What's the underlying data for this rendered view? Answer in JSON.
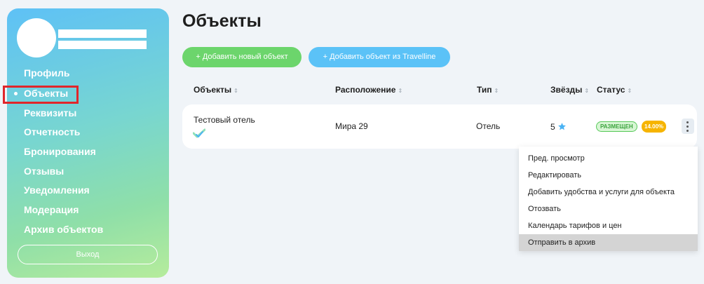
{
  "sidebar": {
    "items": [
      {
        "label": "Профиль"
      },
      {
        "label": "Объекты"
      },
      {
        "label": "Реквизиты"
      },
      {
        "label": "Отчетность"
      },
      {
        "label": "Бронирования"
      },
      {
        "label": "Отзывы"
      },
      {
        "label": "Уведомления"
      },
      {
        "label": "Модерация"
      },
      {
        "label": "Архив объектов"
      }
    ],
    "logout_label": "Выход"
  },
  "page": {
    "title": "Объекты"
  },
  "actions": {
    "add_object": "+ Добавить новый объект",
    "add_from_travelline": "+ Добавить объект из Travelline"
  },
  "table": {
    "columns": [
      "Объекты",
      "Расположение",
      "Тип",
      "Звёзды",
      "Статус"
    ],
    "rows": [
      {
        "name": "Тестовый отель",
        "location": "Мира 29",
        "type": "Отель",
        "stars": "5",
        "status": "РАЗМЕЩЕН",
        "percent": "14.00%"
      }
    ]
  },
  "row_menu": {
    "items": [
      "Пред. просмотр",
      "Редактировать",
      "Добавить удобства и услуги для объекта",
      "Отозвать",
      "Календарь тарифов и цен",
      "Отправить в архив"
    ]
  },
  "colors": {
    "sidebar_gradient_top": "#5ec1f6",
    "sidebar_gradient_bottom": "#b6ec9c",
    "add_button": "#6cd56c",
    "travelline_button": "#5bc2f7",
    "status_badge": "#58c95a",
    "percent_badge": "#f6b400",
    "star": "#4ab3f4"
  }
}
